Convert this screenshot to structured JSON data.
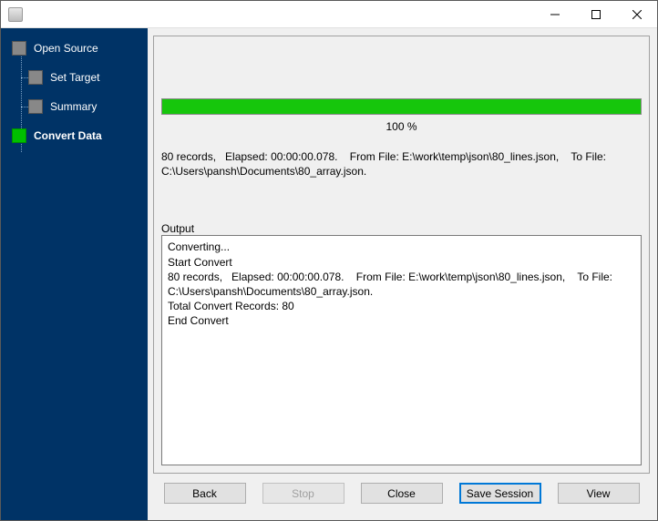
{
  "window": {
    "title": ""
  },
  "sidebar": {
    "items": [
      {
        "label": "Open Source",
        "active": false,
        "child": false
      },
      {
        "label": "Set Target",
        "active": false,
        "child": true
      },
      {
        "label": "Summary",
        "active": false,
        "child": true
      },
      {
        "label": "Convert Data",
        "active": true,
        "child": false
      }
    ]
  },
  "progress": {
    "percent_label": "100 %",
    "percent_value": 100
  },
  "status_line": "80 records,   Elapsed: 00:00:00.078.    From File: E:\\work\\temp\\json\\80_lines.json,    To File: C:\\Users\\pansh\\Documents\\80_array.json.",
  "output": {
    "label": "Output",
    "lines": [
      "Converting...",
      "Start Convert",
      "80 records,   Elapsed: 00:00:00.078.    From File: E:\\work\\temp\\json\\80_lines.json,    To File: C:\\Users\\pansh\\Documents\\80_array.json.",
      "Total Convert Records: 80",
      "End Convert"
    ]
  },
  "buttons": {
    "back": "Back",
    "stop": "Stop",
    "close": "Close",
    "save_session": "Save Session",
    "view": "View"
  }
}
